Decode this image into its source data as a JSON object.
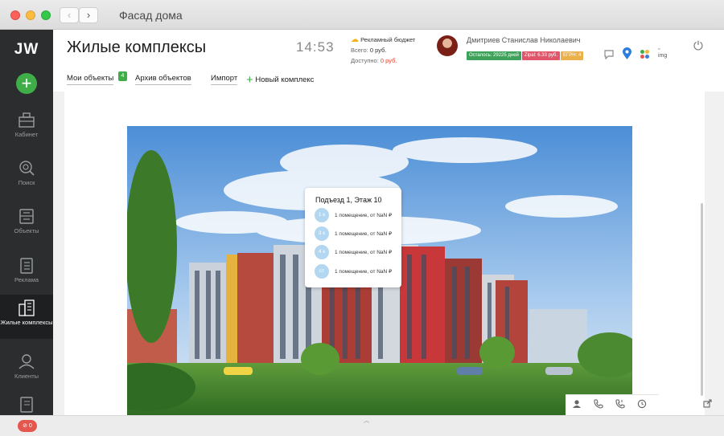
{
  "window": {
    "title": "Фасад дома"
  },
  "sidebar": {
    "logo": "JW",
    "add_label": "+",
    "items": [
      {
        "label": "Кабинет",
        "icon": "briefcase-icon"
      },
      {
        "label": "Поиск",
        "icon": "search-icon"
      },
      {
        "label": "Объекты",
        "icon": "inbox-icon"
      },
      {
        "label": "Реклама",
        "icon": "clipboard-icon"
      },
      {
        "label": "Жилые комплексы",
        "icon": "buildings-icon",
        "active": true
      },
      {
        "label": "Клиенты",
        "icon": "clients-icon"
      },
      {
        "label": "",
        "icon": "list-icon"
      }
    ]
  },
  "header": {
    "title": "Жилые комплексы",
    "clock": "14:53",
    "budget": {
      "title": "Рекламный бюджет",
      "total_label": "Всего:",
      "total_value": "0 руб.",
      "available_label": "Доступно:",
      "available_value": "0 руб."
    },
    "user": {
      "name": "Дмитриев Станислав Николаевич",
      "badges": [
        {
          "text": "Осталось: 29225 дней",
          "color": "#3fa25a"
        },
        {
          "text": "Zipal: 6.33 руб.",
          "color": "#e1556a"
        },
        {
          "text": "ЕГРН: 4",
          "color": "#eab04a"
        }
      ]
    },
    "img_placeholder": "img"
  },
  "tabs": {
    "my_objects": "Мои объекты",
    "my_objects_count": "4",
    "archive": "Архив объектов",
    "import": "Импорт",
    "new_complex": "Новый комплекс"
  },
  "popup": {
    "title": "Подъезд 1, Этаж 10",
    "rows": [
      {
        "badge": "1 к",
        "text": "1 помещение, от NaN ₽"
      },
      {
        "badge": "3 к",
        "text": "1 помещение, от NaN ₽"
      },
      {
        "badge": "4 к",
        "text": "1 помещение, от NaN ₽"
      },
      {
        "badge": "ст",
        "text": "1 помещение, от NaN ₽"
      }
    ]
  },
  "footer": {
    "alert_count": "0"
  },
  "colors": {
    "accent_green": "#3fae49",
    "sidebar_bg": "#2b2d2f",
    "danger_red": "#e4574e"
  }
}
